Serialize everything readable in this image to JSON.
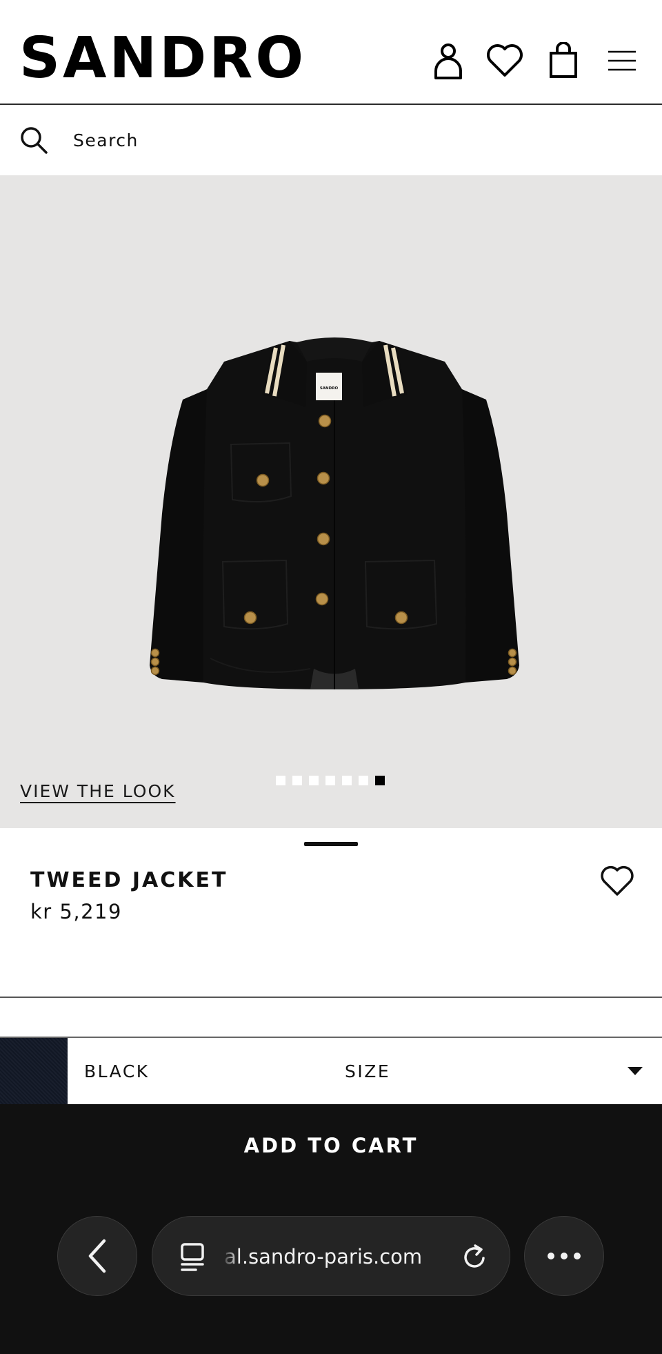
{
  "header": {
    "logo": "SANDRO",
    "icons": [
      "account-icon",
      "wishlist-icon",
      "bag-icon",
      "menu-icon"
    ]
  },
  "search": {
    "placeholder": "Search"
  },
  "gallery": {
    "view_look": "VIEW THE LOOK",
    "image_count": 7,
    "active_index": 7,
    "label_text": "SANDRO"
  },
  "product": {
    "name": "TWEED JACKET",
    "price": "kr 5,219"
  },
  "selector": {
    "color": "BLACK",
    "size_label": "SIZE"
  },
  "cta": {
    "add_to_cart": "ADD TO CART"
  },
  "browser": {
    "url": "al.sandro-paris.com"
  },
  "colors": {
    "header_bg": "#ffffff",
    "gallery_bg": "#e6e5e4",
    "cta_bg": "#111111",
    "swatch": "#121826",
    "gold": "#b8904a"
  }
}
